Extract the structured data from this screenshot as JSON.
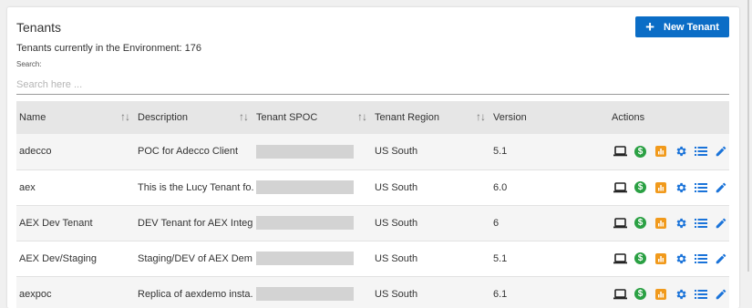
{
  "header": {
    "title": "Tenants",
    "new_button_label": "New Tenant",
    "count_text": "Tenants currently in the Environment: 176"
  },
  "search": {
    "label": "Search:",
    "placeholder": "Search here ...",
    "value": ""
  },
  "table": {
    "columns": {
      "name": "Name",
      "description": "Description",
      "spoc": "Tenant SPOC",
      "region": "Tenant Region",
      "version": "Version",
      "actions": "Actions"
    },
    "rows": [
      {
        "name": "adecco",
        "description": "POC for Adecco Client",
        "region": "US South",
        "version": "5.1"
      },
      {
        "name": "aex",
        "description": "This is the Lucy Tenant fo...",
        "region": "US South",
        "version": "6.0"
      },
      {
        "name": "AEX Dev Tenant",
        "description": "DEV Tenant for AEX Integr...",
        "region": "US South",
        "version": "6"
      },
      {
        "name": "AEX Dev/Staging",
        "description": "Staging/DEV of AEX Dem...",
        "region": "US South",
        "version": "5.1"
      },
      {
        "name": "aexpoc",
        "description": "Replica of aexdemo insta...",
        "region": "US South",
        "version": "6.1"
      }
    ]
  },
  "icons": {
    "actions": [
      "laptop-icon",
      "dollar-icon",
      "chart-icon",
      "gear-icon",
      "list-icon",
      "pencil-icon"
    ]
  },
  "colors": {
    "primary": "#0b6dc6",
    "dollar": "#2aa043",
    "chart": "#f19a1c",
    "icon_blue": "#1a73d9"
  }
}
